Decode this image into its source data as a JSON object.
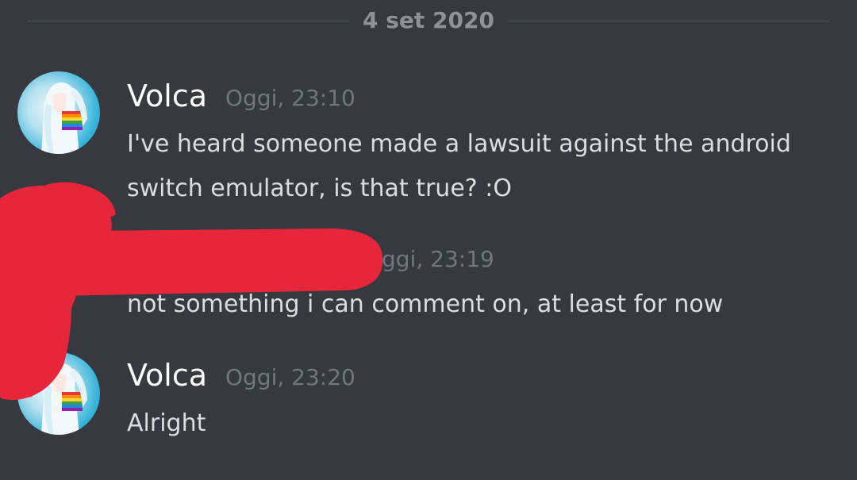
{
  "date_divider": {
    "label": "4 set 2020"
  },
  "messages": [
    {
      "author": "Volca",
      "time": "Oggi, 23:10",
      "lines": [
        "I've heard someone made a lawsuit against the android",
        "switch emulator, is that true? :O"
      ]
    },
    {
      "author": "",
      "time": "ggi, 23:19",
      "lines": [
        "not something i can comment on, at least for now"
      ]
    },
    {
      "author": "Volca",
      "time": "Oggi, 23:20",
      "lines": [
        "Alright"
      ]
    }
  ],
  "avatar": {
    "icon": "anime-character-avatar-icon"
  },
  "colors": {
    "background": "#36393f",
    "username": "#ffffff",
    "timestamp": "#72767d",
    "message": "#dcddde",
    "divider_text": "#8e9297",
    "censor": "#e8263b"
  }
}
